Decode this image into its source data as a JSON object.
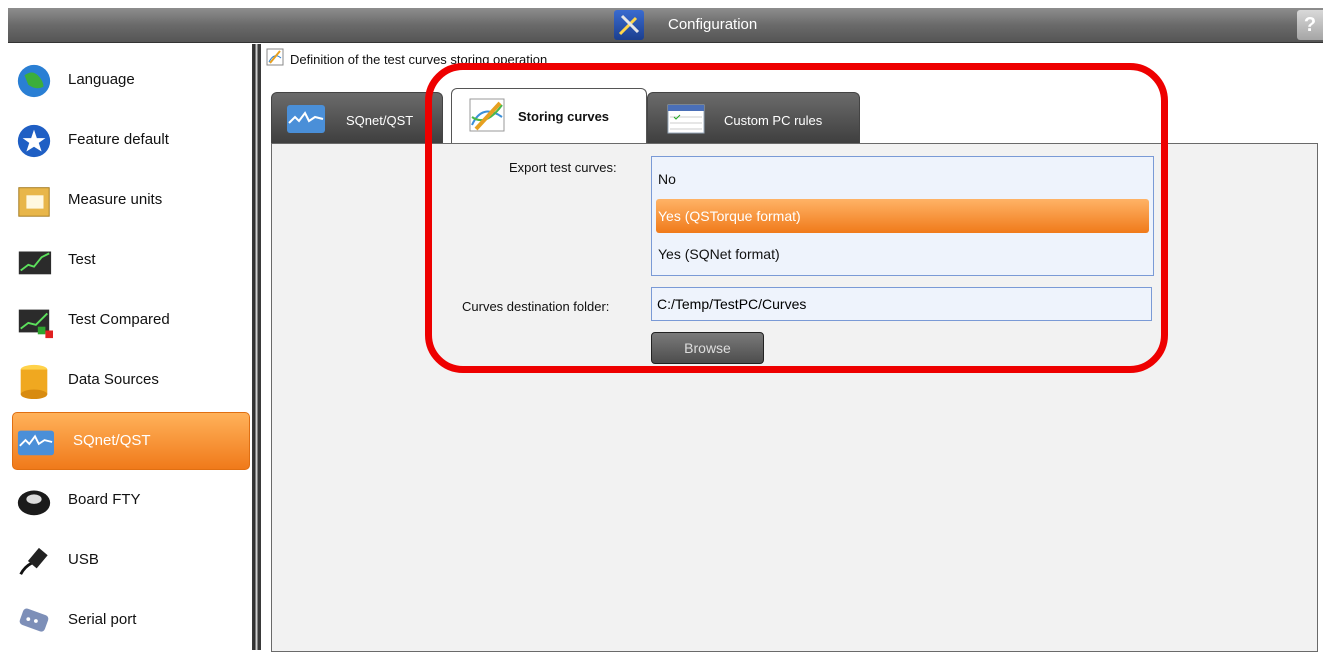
{
  "window": {
    "title": "Configuration",
    "help_label": "?"
  },
  "sidebar": {
    "items": [
      {
        "label": "Language",
        "icon": "globe-icon"
      },
      {
        "label": "Feature default",
        "icon": "star-icon"
      },
      {
        "label": "Measure units",
        "icon": "ruler-icon"
      },
      {
        "label": "Test",
        "icon": "chart-icon"
      },
      {
        "label": "Test Compared",
        "icon": "chart-compare-icon"
      },
      {
        "label": "Data Sources",
        "icon": "database-icon"
      },
      {
        "label": "SQnet/QST",
        "icon": "waveform-icon",
        "active": true
      },
      {
        "label": "Board FTY",
        "icon": "board-icon"
      },
      {
        "label": "USB",
        "icon": "usb-icon"
      },
      {
        "label": "Serial port",
        "icon": "serial-port-icon"
      }
    ]
  },
  "main": {
    "header": "Definition of the test curves storing operation",
    "tabs": [
      {
        "label": "SQnet/QST",
        "icon": "waveform-icon"
      },
      {
        "label": "Storing curves",
        "icon": "curves-pencil-icon",
        "active": true
      },
      {
        "label": "Custom PC rules",
        "icon": "rules-table-icon"
      }
    ],
    "export": {
      "label": "Export test curves:",
      "options": [
        "No",
        "Yes (QSTorque format)",
        "Yes (SQNet format)"
      ],
      "selected": "Yes (QSTorque format)"
    },
    "folder": {
      "label": "Curves destination folder:",
      "value": "C:/Temp/TestPC/Curves"
    },
    "browse_label": "Browse"
  },
  "colors": {
    "accent": "#f07a1a",
    "highlight": "#ee0000",
    "list_bg": "#eef3fc"
  }
}
